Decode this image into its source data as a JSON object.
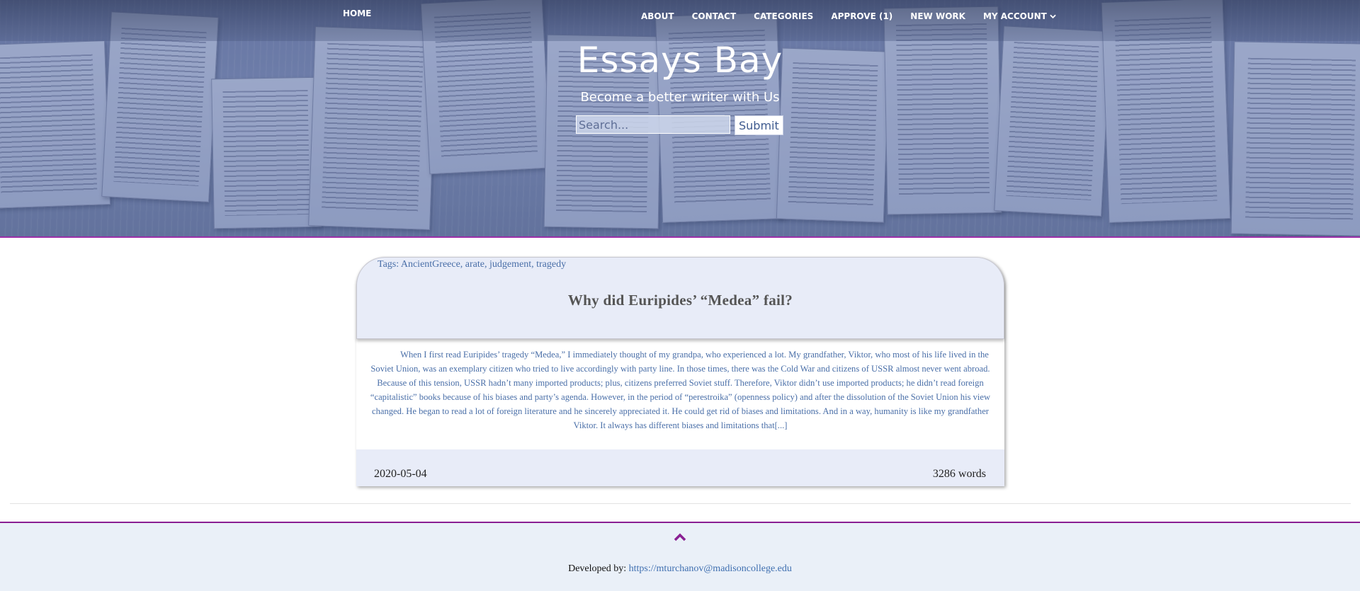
{
  "nav": {
    "home": "HOME",
    "links": [
      "ABOUT",
      "CONTACT",
      "CATEGORIES",
      "APPROVE (1)",
      "NEW WORK",
      "MY ACCOUNT"
    ],
    "account_icon": "chevron-down-icon"
  },
  "hero": {
    "title": "Essays Bay",
    "subtitle": "Become a better writer with Us",
    "search_placeholder": "Search...",
    "submit_label": "Submit"
  },
  "essay": {
    "tags": "Tags: AncientGreece, arate, judgement, tragedy",
    "title": "Why did Euripides’ “Medea” fail?",
    "excerpt": "When I first read Euripides’ tragedy “Medea,” I immediately thought of my grandpa, who experienced a lot. My grandfather, Viktor, who most of his life lived in the Soviet Union, was an exemplary citizen who tried to live accordingly with party line. In those times, there was the Cold War and citizens of USSR almost never went abroad. Because of this tension, USSR hadn’t many imported products; plus, citizens preferred Soviet stuff. Therefore, Viktor didn’t use imported products; he didn’t read foreign “capitalistic” books because of his biases and party’s agenda. However, in the period of “perestroika” (openness policy) and after the dissolution of the Soviet Union his view changed. He began to read a lot of foreign literature and he sincerely appreciated it. He could get rid of biases and limitations. And in a way, humanity is like my grandfather Viktor. It always has different biases and limitations that[...]",
    "date": "2020-05-04",
    "words": "3286 words"
  },
  "footer": {
    "up_icon": "chevron-up-icon",
    "developed_by": "Developed by:",
    "link": "https://mturchanov@madisoncollege.edu"
  },
  "colors": {
    "accent_border": "#9b2fa8",
    "link_blue": "#4a6fa8",
    "card_bg": "#e8ecf8",
    "footer_bg": "#eaf0f8"
  }
}
